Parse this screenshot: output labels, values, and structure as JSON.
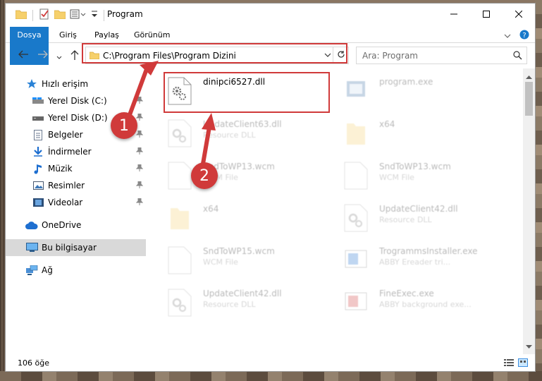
{
  "window": {
    "title": "Program",
    "controls": [
      "minimize-icon",
      "maximize-icon",
      "close-icon"
    ]
  },
  "ribbon": {
    "tabs": [
      {
        "label": "Dosya",
        "active": true
      },
      {
        "label": "Giriş"
      },
      {
        "label": "Paylaş"
      },
      {
        "label": "Görünüm"
      }
    ]
  },
  "address_bar": {
    "path": "C:\\Program Files\\Program Dizini"
  },
  "search": {
    "placeholder": "Ara: Program"
  },
  "sidebar": {
    "items": [
      {
        "label": "Hızlı erişim",
        "icon": "star-icon"
      },
      {
        "label": "Yerel Disk (C:)",
        "icon": "drive-icon",
        "pinned": true
      },
      {
        "label": "Yerel Disk (D:)",
        "icon": "drive-icon",
        "pinned": true
      },
      {
        "label": "Belgeler",
        "icon": "documents-icon",
        "pinned": true
      },
      {
        "label": "İndirmeler",
        "icon": "download-icon",
        "pinned": true
      },
      {
        "label": "Müzik",
        "icon": "music-icon",
        "pinned": true
      },
      {
        "label": "Resimler",
        "icon": "pictures-icon",
        "pinned": true
      },
      {
        "label": "Videolar",
        "icon": "videos-icon",
        "pinned": true
      },
      {
        "label": "OneDrive",
        "icon": "cloud-icon"
      },
      {
        "label": "Bu bilgisayar",
        "icon": "computer-icon",
        "selected": true
      },
      {
        "label": "Ağ",
        "icon": "network-icon"
      }
    ]
  },
  "files": [
    {
      "name": "dinipci6527.dll",
      "type": "",
      "icon": "dll-gear-icon",
      "highlighted": true
    },
    {
      "name": "program.exe",
      "type": "",
      "icon": "exe-icon"
    },
    {
      "name": "UpdateClient63.dll",
      "type": "Resource DLL",
      "icon": "dll-gear-icon"
    },
    {
      "name": "x64",
      "type": "",
      "icon": "folder-icon"
    },
    {
      "name": "SndToWP13.wcm",
      "type": "WCM File",
      "icon": "file-icon"
    },
    {
      "name": "SndToWP13.wcm",
      "type": "WCM File",
      "icon": "file-icon"
    },
    {
      "name": "x64",
      "type": "",
      "icon": "folder-icon"
    },
    {
      "name": "UpdateClient42.dll",
      "type": "Resource DLL",
      "icon": "dll-gear-icon"
    },
    {
      "name": "SndToWP15.wcm",
      "type": "WCM File",
      "icon": "file-icon"
    },
    {
      "name": "TrogrammsInstaller.exe",
      "type": "ABBY Ereader tri...",
      "icon": "installer-icon"
    },
    {
      "name": "UpdateClient42.dll",
      "type": "Resource DLL",
      "icon": "dll-gear-icon"
    },
    {
      "name": "FineExec.exe",
      "type": "ABBY background exe...",
      "icon": "installer-icon"
    }
  ],
  "status": {
    "count": "106 öğe"
  },
  "annotations": {
    "badge1": "1",
    "badge2": "2",
    "color": "#d03a3a"
  }
}
